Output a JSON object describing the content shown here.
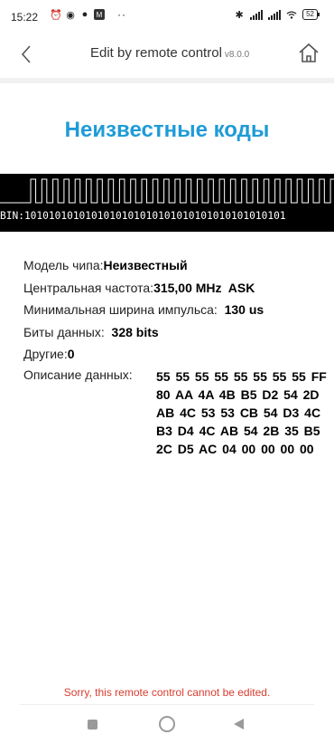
{
  "status_bar": {
    "time": "15:22",
    "dots": "··",
    "battery": "52"
  },
  "header": {
    "title": "Edit by remote control",
    "version": "v8.0.0"
  },
  "page_title": "Неизвестные коды",
  "binary_text": "BIN:1010101010101010101010101010101010101010101",
  "info": {
    "chip_label": "Модель чипа:",
    "chip_value": "Неизвестный",
    "freq_label": "Центральная частота:",
    "freq_value": "315,00 MHz  ASK",
    "pulse_label": "Минимальная ширина импульса:",
    "pulse_value": "130 us",
    "bits_label": "Биты данных:",
    "bits_value": "328 bits",
    "other_label": "Другие:",
    "other_value": "0",
    "desc_label": "Описание данных:",
    "desc_value": "55 55 55 55 55 55 55 55 FF 80 AA 4A 4B B5 D2 54 2D AB 4C 53 53 CB 54 D3 4C B3 D4 4C AB 54 2B 35 B5 2C D5 AC 04 00 00 00 00"
  },
  "error_message": "Sorry, this remote control cannot be edited.",
  "colors": {
    "accent": "#1f9bd7",
    "error": "#d83c2e"
  }
}
